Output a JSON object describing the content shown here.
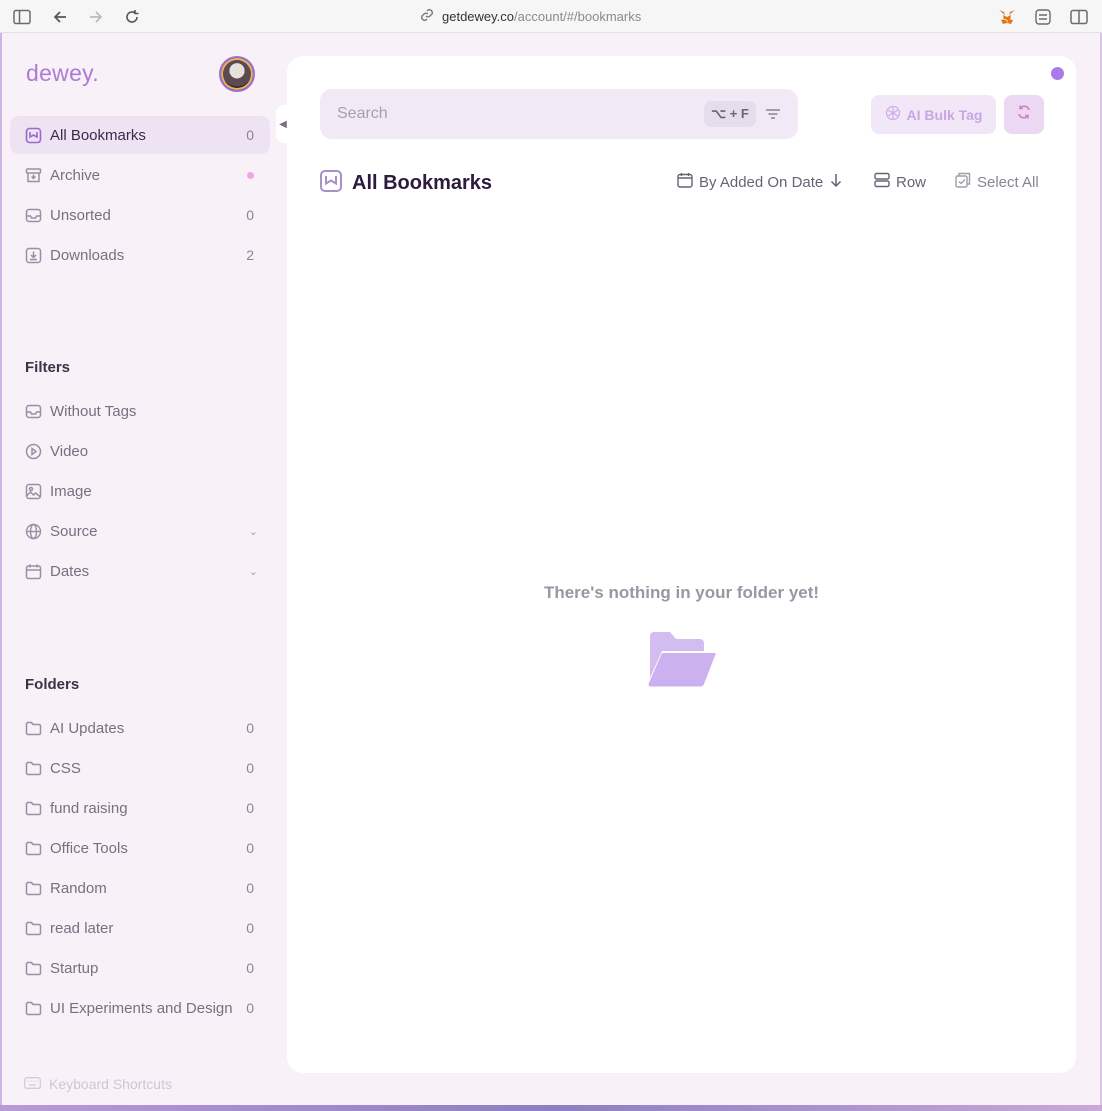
{
  "browser": {
    "url_domain": "getdewey.co",
    "url_path": "/account/#/bookmarks"
  },
  "app": {
    "logo": "dewey.",
    "accent": "#9a69d0"
  },
  "sidebar": {
    "main_items": [
      {
        "label": "All Bookmarks",
        "count": "0",
        "icon": "bookmark-icon",
        "active": true
      },
      {
        "label": "Archive",
        "count": "",
        "icon": "archive-icon",
        "indicator": "dot"
      },
      {
        "label": "Unsorted",
        "count": "0",
        "icon": "inbox-icon"
      },
      {
        "label": "Downloads",
        "count": "2",
        "icon": "download-icon"
      }
    ],
    "filters_title": "Filters",
    "filters": [
      {
        "label": "Without Tags",
        "icon": "inbox-icon"
      },
      {
        "label": "Video",
        "icon": "play-icon"
      },
      {
        "label": "Image",
        "icon": "image-icon"
      },
      {
        "label": "Source",
        "icon": "globe-icon",
        "expandable": true
      },
      {
        "label": "Dates",
        "icon": "calendar-icon",
        "expandable": true
      }
    ],
    "folders_title": "Folders",
    "folders": [
      {
        "label": "AI Updates",
        "count": "0"
      },
      {
        "label": "CSS",
        "count": "0"
      },
      {
        "label": "fund raising",
        "count": "0"
      },
      {
        "label": "Office Tools",
        "count": "0"
      },
      {
        "label": "Random",
        "count": "0"
      },
      {
        "label": "read later",
        "count": "0"
      },
      {
        "label": "Startup",
        "count": "0"
      },
      {
        "label": "UI Experiments and Design",
        "count": "0"
      }
    ],
    "keyboard_shortcuts": "Keyboard Shortcuts"
  },
  "main": {
    "search": {
      "placeholder": "Search",
      "shortcut": "⌥ + F"
    },
    "bulk_tag_label": "AI Bulk Tag",
    "title": "All Bookmarks",
    "sort_label": "By Added On Date",
    "view_label": "Row",
    "select_all_label": "Select All",
    "empty_message": "There's nothing in your folder yet!"
  }
}
